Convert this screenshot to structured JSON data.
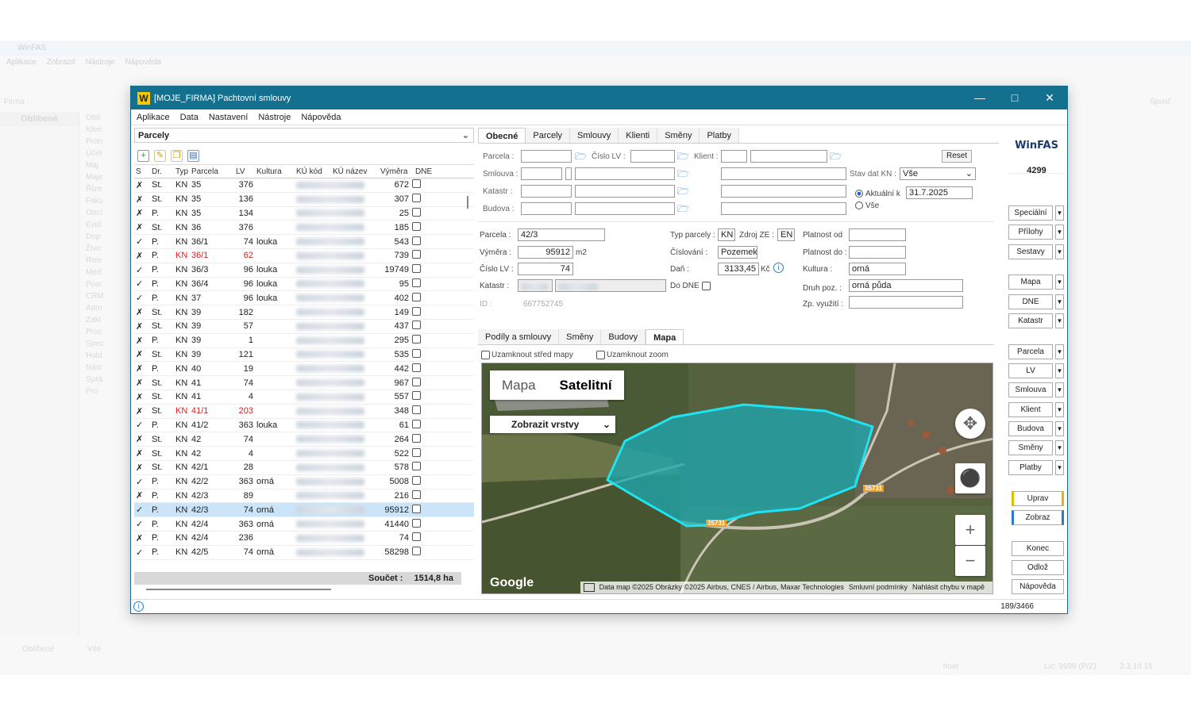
{
  "bg": {
    "title": "WinFAS",
    "menu": [
      "Aplikace",
      "Zobrazit",
      "Nástroje",
      "Nápověda"
    ],
    "firma_label": "Firma :",
    "spust": "Spusť",
    "oblibene": "Oblíbené",
    "tree": [
      "Oblí",
      "Kleri",
      "Pron",
      "Účet",
      "Maj",
      "Maje",
      "Říze",
      "Faks",
      "Obcí",
      "Evid",
      "Dop",
      "Živo",
      "Rosr",
      "Med",
      "Posr",
      "CRM",
      "Adm",
      "Zakl",
      "Proc",
      "Spec",
      "Hold",
      "Nást",
      "Sprá",
      "Pro"
    ],
    "foot_left": "Oblíbené",
    "foot_mid": "Vše",
    "status_user": "host",
    "status_lic": "Lic: 9999 (P/Z)",
    "status_ver": "3.3.10.15"
  },
  "window": {
    "title": "[MOJE_FIRMA] Pachtovní smlouvy",
    "logo": "W",
    "menu": [
      "Aplikace",
      "Data",
      "Nastavení",
      "Nástroje",
      "Nápověda"
    ]
  },
  "left": {
    "header": "Parcely",
    "columns": [
      "S",
      "Dr.",
      "Typ",
      "Parcela",
      "LV",
      "Kultura",
      "KÚ kód",
      "KÚ název",
      "Výměra",
      "DNE"
    ],
    "rows": [
      {
        "s": "✗",
        "dr": "St.",
        "typ": "KN",
        "parcela": "35",
        "lv": "376",
        "kultura": "",
        "vymera": "672",
        "red": false,
        "sel": false
      },
      {
        "s": "✗",
        "dr": "St.",
        "typ": "KN",
        "parcela": "35",
        "lv": "136",
        "kultura": "",
        "vymera": "307",
        "red": false,
        "sel": false
      },
      {
        "s": "✗",
        "dr": "P.",
        "typ": "KN",
        "parcela": "35",
        "lv": "134",
        "kultura": "",
        "vymera": "25",
        "red": false,
        "sel": false
      },
      {
        "s": "✗",
        "dr": "St.",
        "typ": "KN",
        "parcela": "36",
        "lv": "376",
        "kultura": "",
        "vymera": "185",
        "red": false,
        "sel": false
      },
      {
        "s": "✓",
        "dr": "P.",
        "typ": "KN",
        "parcela": "36/1",
        "lv": "74",
        "kultura": "louka",
        "vymera": "543",
        "red": false,
        "sel": false
      },
      {
        "s": "✗",
        "dr": "P.",
        "typ": "KN",
        "parcela": "36/1",
        "lv": "62",
        "kultura": "",
        "vymera": "739",
        "red": true,
        "sel": false
      },
      {
        "s": "✓",
        "dr": "P.",
        "typ": "KN",
        "parcela": "36/3",
        "lv": "96",
        "kultura": "louka",
        "vymera": "19749",
        "red": false,
        "sel": false
      },
      {
        "s": "✓",
        "dr": "P.",
        "typ": "KN",
        "parcela": "36/4",
        "lv": "96",
        "kultura": "louka",
        "vymera": "95",
        "red": false,
        "sel": false
      },
      {
        "s": "✓",
        "dr": "P.",
        "typ": "KN",
        "parcela": "37",
        "lv": "96",
        "kultura": "louka",
        "vymera": "402",
        "red": false,
        "sel": false
      },
      {
        "s": "✗",
        "dr": "St.",
        "typ": "KN",
        "parcela": "39",
        "lv": "182",
        "kultura": "",
        "vymera": "149",
        "red": false,
        "sel": false
      },
      {
        "s": "✗",
        "dr": "St.",
        "typ": "KN",
        "parcela": "39",
        "lv": "57",
        "kultura": "",
        "vymera": "437",
        "red": false,
        "sel": false
      },
      {
        "s": "✗",
        "dr": "P.",
        "typ": "KN",
        "parcela": "39",
        "lv": "1",
        "kultura": "",
        "vymera": "295",
        "red": false,
        "sel": false
      },
      {
        "s": "✗",
        "dr": "St.",
        "typ": "KN",
        "parcela": "39",
        "lv": "121",
        "kultura": "",
        "vymera": "535",
        "red": false,
        "sel": false
      },
      {
        "s": "✗",
        "dr": "P.",
        "typ": "KN",
        "parcela": "40",
        "lv": "19",
        "kultura": "",
        "vymera": "442",
        "red": false,
        "sel": false
      },
      {
        "s": "✗",
        "dr": "St.",
        "typ": "KN",
        "parcela": "41",
        "lv": "74",
        "kultura": "",
        "vymera": "967",
        "red": false,
        "sel": false
      },
      {
        "s": "✗",
        "dr": "St.",
        "typ": "KN",
        "parcela": "41",
        "lv": "4",
        "kultura": "",
        "vymera": "557",
        "red": false,
        "sel": false
      },
      {
        "s": "✗",
        "dr": "St.",
        "typ": "KN",
        "parcela": "41/1",
        "lv": "203",
        "kultura": "",
        "vymera": "348",
        "red": true,
        "sel": false
      },
      {
        "s": "✓",
        "dr": "P.",
        "typ": "KN",
        "parcela": "41/2",
        "lv": "363",
        "kultura": "louka",
        "vymera": "61",
        "red": false,
        "sel": false
      },
      {
        "s": "✗",
        "dr": "St.",
        "typ": "KN",
        "parcela": "42",
        "lv": "74",
        "kultura": "",
        "vymera": "264",
        "red": false,
        "sel": false
      },
      {
        "s": "✗",
        "dr": "St.",
        "typ": "KN",
        "parcela": "42",
        "lv": "4",
        "kultura": "",
        "vymera": "522",
        "red": false,
        "sel": false
      },
      {
        "s": "✗",
        "dr": "St.",
        "typ": "KN",
        "parcela": "42/1",
        "lv": "28",
        "kultura": "",
        "vymera": "578",
        "red": false,
        "sel": false
      },
      {
        "s": "✓",
        "dr": "P.",
        "typ": "KN",
        "parcela": "42/2",
        "lv": "363",
        "kultura": "orná",
        "vymera": "5008",
        "red": false,
        "sel": false
      },
      {
        "s": "✗",
        "dr": "P.",
        "typ": "KN",
        "parcela": "42/3",
        "lv": "89",
        "kultura": "",
        "vymera": "216",
        "red": false,
        "sel": false
      },
      {
        "s": "✓",
        "dr": "P.",
        "typ": "KN",
        "parcela": "42/3",
        "lv": "74",
        "kultura": "orná",
        "vymera": "95912",
        "red": false,
        "sel": true
      },
      {
        "s": "✓",
        "dr": "P.",
        "typ": "KN",
        "parcela": "42/4",
        "lv": "363",
        "kultura": "orná",
        "vymera": "41440",
        "red": false,
        "sel": false
      },
      {
        "s": "✗",
        "dr": "P.",
        "typ": "KN",
        "parcela": "42/4",
        "lv": "236",
        "kultura": "",
        "vymera": "74",
        "red": false,
        "sel": false
      },
      {
        "s": "✓",
        "dr": "P.",
        "typ": "KN",
        "parcela": "42/5",
        "lv": "74",
        "kultura": "orná",
        "vymera": "58298",
        "red": false,
        "sel": false
      }
    ],
    "sum_label": "Součet :",
    "sum_value": "1514,8 ha"
  },
  "mid": {
    "tabs": [
      "Obecné",
      "Parcely",
      "Smlouvy",
      "Klienti",
      "Směny",
      "Platby"
    ],
    "filter": {
      "parcela": "Parcela :",
      "cislo_lv": "Číslo LV :",
      "klient": "Klient :",
      "smlouva": "Smlouva :",
      "katastr": "Katastr :",
      "budova": "Budova :",
      "reset": "Reset",
      "stav_label": "Stav dat KN :",
      "stav_value": "Vše",
      "aktualni": "Aktuální k",
      "date": "31.7.2025",
      "vse": "Vše"
    },
    "detail": {
      "parcela_l": "Parcela :",
      "parcela_v": "42/3",
      "vymera_l": "Výměra :",
      "vymera_v": "95912",
      "vymera_u": "m2",
      "cislo_lv_l": "Číslo LV :",
      "cislo_lv_v": "74",
      "katastr_l": "Katastr :",
      "id_l": "ID :",
      "id_v": "667752745",
      "typ_l": "Typ parcely :",
      "typ_v": "KN",
      "zdroj_l": "Zdroj ZE :",
      "zdroj_v": "EN",
      "cislovani_l": "Číslování :",
      "cislovani_v": "Pozemek",
      "dan_l": "Daň :",
      "dan_v": "3133,45",
      "dan_u": "Kč",
      "dodne_l": "Do DNE",
      "platnost_od": "Platnost od",
      "platnost_do": "Platnost do :",
      "kultura_l": "Kultura :",
      "kultura_v": "orná",
      "druh_l": "Druh poz. :",
      "druh_v": "orná půda",
      "zp_l": "Zp. využití :"
    },
    "subtabs": [
      "Podíly a smlouvy",
      "Směny",
      "Budovy",
      "Mapa"
    ],
    "lock_center": "Uzamknout střed mapy",
    "lock_zoom": "Uzamknout zoom",
    "map": {
      "btn_map": "Mapa",
      "btn_sat": "Satelitní",
      "layers": "Zobrazit vrstvy",
      "google": "Google",
      "road1": "35731",
      "road2": "35731",
      "attrib": [
        "Data map ©2025 Obrázky ©2025 Airbus, CNES / Airbus, Maxar Technologies",
        "Smluvní podmínky",
        "Nahlásit chybu v mapě"
      ]
    }
  },
  "right": {
    "brand": "WinFAS",
    "count": "4299",
    "buttons": [
      "Speciální",
      "Přílohy",
      "Sestavy",
      "Mapa",
      "DNE",
      "Katastr",
      "Parcela",
      "LV",
      "Smlouva",
      "Klient",
      "Budova",
      "Směny",
      "Platby"
    ],
    "actions": [
      "Uprav",
      "Zobraz",
      "Konec",
      "Odlož",
      "Nápověda"
    ]
  },
  "status": {
    "info_icon": "i",
    "record": "189/3466"
  },
  "colors": {
    "titlebar": "#14708f",
    "selection": "#cce4f7",
    "parcel": "#1fd3e0"
  }
}
